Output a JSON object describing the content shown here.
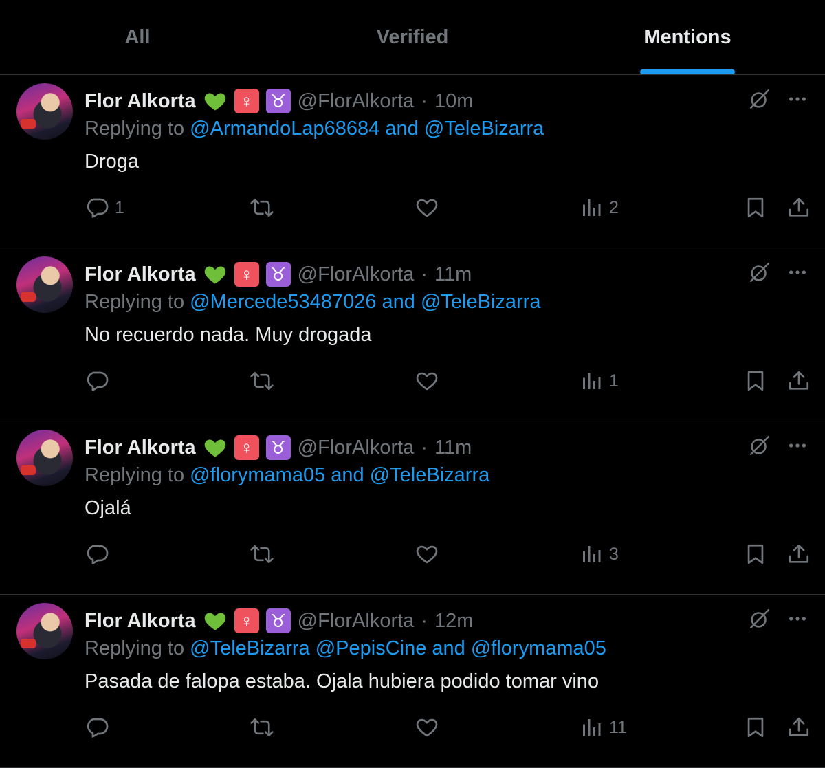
{
  "tabs": [
    {
      "label": "All",
      "active": false
    },
    {
      "label": "Verified",
      "active": false
    },
    {
      "label": "Mentions",
      "active": true
    }
  ],
  "accent_color": "#1d9bf0",
  "tweets": [
    {
      "name": "Flor Alkorta",
      "emojis": [
        "green-heart",
        "female-sign",
        "taurus"
      ],
      "handle": "@FlorAlkorta",
      "separator": "·",
      "time": "10m",
      "replying_prefix": "Replying to",
      "replying_mentions": [
        {
          "text": "@ArmandoLap68684"
        },
        {
          "text": "and",
          "connector": true
        },
        {
          "text": "@TeleBizarra"
        }
      ],
      "text": "Droga",
      "replies": "1",
      "retweets": "",
      "likes": "",
      "views": "2"
    },
    {
      "name": "Flor Alkorta",
      "emojis": [
        "green-heart",
        "female-sign",
        "taurus"
      ],
      "handle": "@FlorAlkorta",
      "separator": "·",
      "time": "11m",
      "replying_prefix": "Replying to",
      "replying_mentions": [
        {
          "text": "@Mercede53487026"
        },
        {
          "text": "and",
          "connector": true
        },
        {
          "text": "@TeleBizarra"
        }
      ],
      "text": "No recuerdo nada. Muy drogada",
      "replies": "",
      "retweets": "",
      "likes": "",
      "views": "1"
    },
    {
      "name": "Flor Alkorta",
      "emojis": [
        "green-heart",
        "female-sign",
        "taurus"
      ],
      "handle": "@FlorAlkorta",
      "separator": "·",
      "time": "11m",
      "replying_prefix": "Replying to",
      "replying_mentions": [
        {
          "text": "@florymama05"
        },
        {
          "text": "and",
          "connector": true
        },
        {
          "text": "@TeleBizarra"
        }
      ],
      "text": "Ojalá",
      "replies": "",
      "retweets": "",
      "likes": "",
      "views": "3"
    },
    {
      "name": "Flor Alkorta",
      "emojis": [
        "green-heart",
        "female-sign",
        "taurus"
      ],
      "handle": "@FlorAlkorta",
      "separator": "·",
      "time": "12m",
      "replying_prefix": "Replying to",
      "replying_mentions": [
        {
          "text": "@TeleBizarra"
        },
        {
          "text": "@PepisCine"
        },
        {
          "text": "and",
          "connector": true
        },
        {
          "text": "@florymama05"
        }
      ],
      "text": "Pasada de falopa estaba. Ojala hubiera podido tomar vino",
      "replies": "",
      "retweets": "",
      "likes": "",
      "views": "11"
    }
  ]
}
